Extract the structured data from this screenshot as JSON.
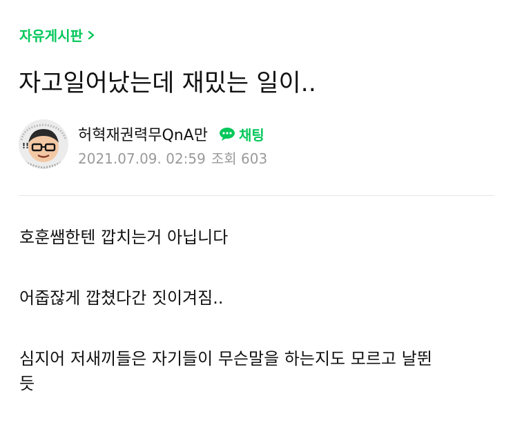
{
  "board": {
    "label": "자유게시판"
  },
  "post": {
    "title": "자고일어났는데 재밌는 일이..",
    "author": "허혁재권력무QnA만",
    "chat_label": "채팅",
    "date": "2021.07.09. 02:59",
    "views_label": "조회",
    "views": "603",
    "paragraphs": [
      "호훈쌤한텐 깝치는거 아닙니다",
      "어줍잖게 깝쳤다간 짓이겨짐..",
      "심지어 저새끼들은 자기들이 무슨말을 하는지도 모르고 날뛴",
      "듯"
    ]
  },
  "colors": {
    "accent": "#03c75a",
    "meta": "#9a9a9a",
    "divider": "#e6e6e6"
  },
  "icons": {
    "board": "chevron-right-icon",
    "chat": "speech-bubble-icon"
  }
}
